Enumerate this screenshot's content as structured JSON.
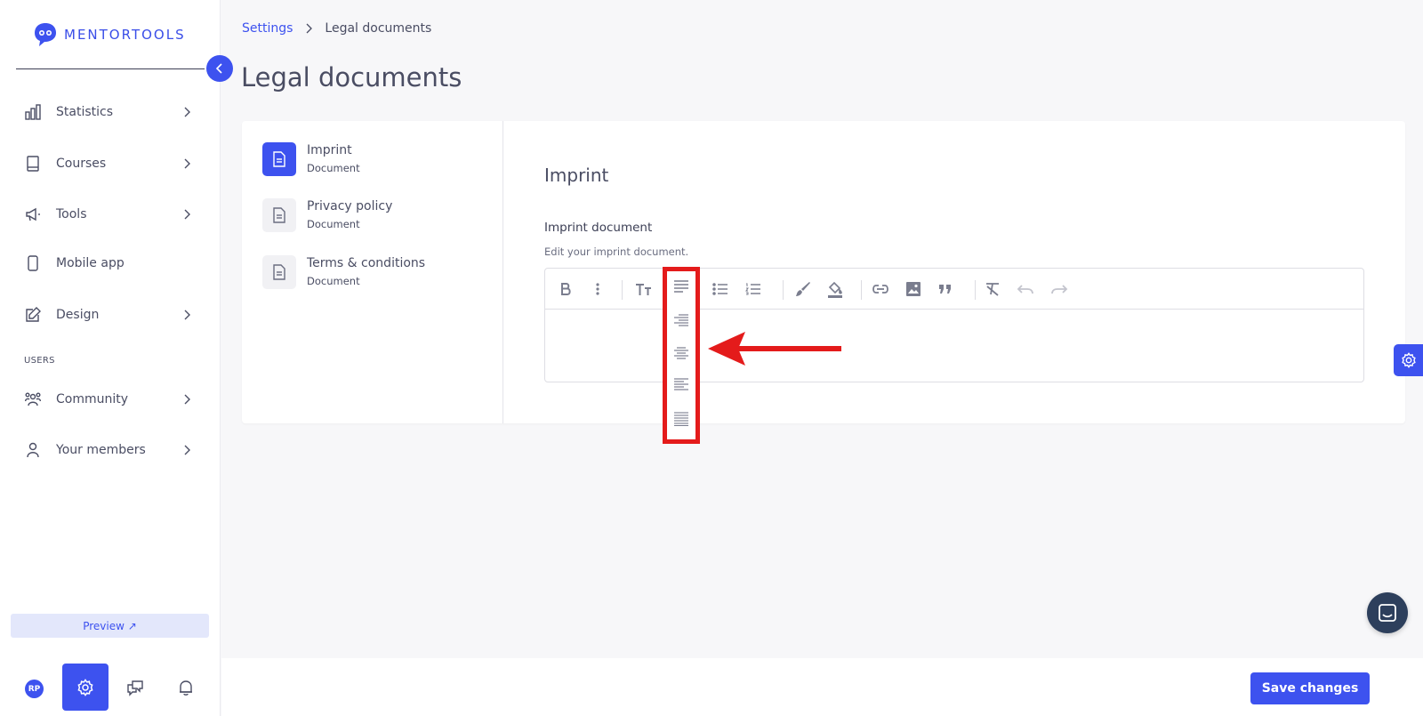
{
  "brand": {
    "name": "MENTORTOOLS",
    "accent": "#3d52ef"
  },
  "sidebar": {
    "items": [
      {
        "label": "Statistics",
        "icon": "bar-chart-icon"
      },
      {
        "label": "Courses",
        "icon": "book-icon"
      },
      {
        "label": "Tools",
        "icon": "megaphone-icon"
      },
      {
        "label": "Mobile app",
        "icon": "phone-icon"
      },
      {
        "label": "Design",
        "icon": "edit-icon"
      }
    ],
    "section_label": "USERS",
    "user_items": [
      {
        "label": "Community",
        "icon": "community-icon"
      },
      {
        "label": "Your members",
        "icon": "user-icon"
      }
    ],
    "preview_label": "Preview ↗",
    "avatar_initials": "RP"
  },
  "breadcrumb": {
    "parent": "Settings",
    "current": "Legal documents"
  },
  "page_title": "Legal documents",
  "documents": [
    {
      "title": "Imprint",
      "subtitle": "Document",
      "active": true
    },
    {
      "title": "Privacy policy",
      "subtitle": "Document",
      "active": false
    },
    {
      "title": "Terms & conditions",
      "subtitle": "Document",
      "active": false
    }
  ],
  "editor": {
    "heading": "Imprint",
    "field_label": "Imprint document",
    "field_help": "Edit your imprint document.",
    "toolbar": [
      "bold",
      "more",
      "text-size",
      "align",
      "bullet-list",
      "numbered-list",
      "brush",
      "fill-color",
      "link",
      "image",
      "quote",
      "clear-format",
      "undo",
      "redo"
    ],
    "align_options": [
      "align-left",
      "align-right",
      "align-center",
      "align-left-short",
      "align-justify"
    ]
  },
  "actions": {
    "save_label": "Save changes"
  },
  "annotation_color": "#e41b1b"
}
